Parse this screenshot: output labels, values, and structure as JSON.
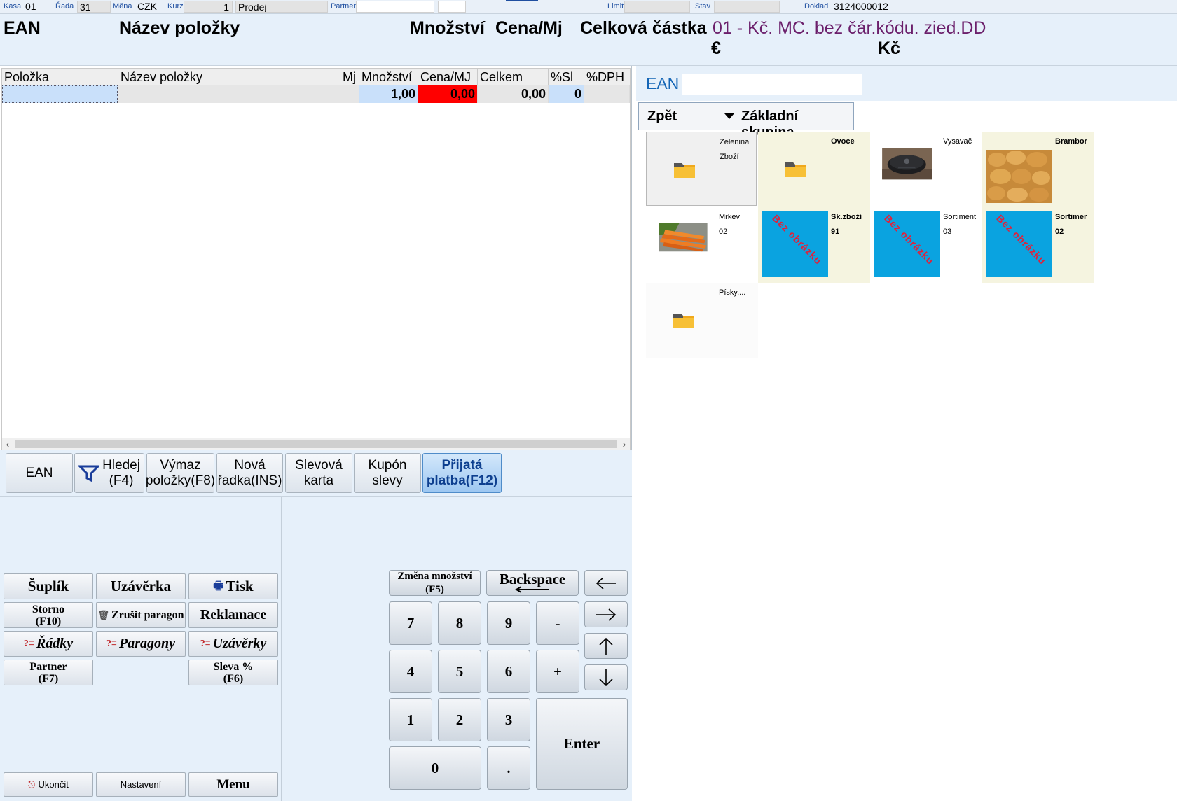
{
  "topbar": {
    "kasa_label": "Kasa",
    "kasa": "01",
    "rada_label": "Řada",
    "rada": "31",
    "mena_label": "Měna",
    "mena": "CZK",
    "kurz_label": "Kurz",
    "kurz": "1",
    "mode": "Prodej",
    "partner_label": "Partner",
    "partner": "",
    "limit_label": "Limit",
    "limit": "",
    "stav_label": "Stav",
    "stav": "",
    "doklad_label": "Doklad",
    "doklad": "3124000012"
  },
  "header": {
    "ean": "EAN",
    "nazev": "Název položky",
    "mnozstvi": "Množství",
    "cena": "Cena/Mj",
    "celkova": "Celková částka",
    "price_list": "01 - Kč. MC. bez čár.kódu. zied.DD",
    "currency_eur": "€",
    "currency_czk": "Kč"
  },
  "grid": {
    "columns": [
      "Položka",
      "Název položky",
      "Mj",
      "Množství",
      "Cena/MJ",
      "Celkem",
      "%Sl",
      "%DPH"
    ],
    "row": {
      "polozka": "",
      "nazev": "",
      "mj": "",
      "mnozstvi": "1,00",
      "cena": "0,00",
      "celkem": "0,00",
      "sl": "0",
      "dph": ""
    }
  },
  "func_buttons": {
    "ean": "EAN",
    "hledej_1": "Hledej",
    "hledej_2": "(F4)",
    "vymaz_1": "Výmaz",
    "vymaz_2": "položky(F8)",
    "nova_1": "Nová",
    "nova_2": "řadka(INS)",
    "slevova_1": "Slevová",
    "slevova_2": "karta",
    "kupon_1": "Kupón",
    "kupon_2": "slevy",
    "prijata_1": "Přijatá",
    "prijata_2": "platba(F12)"
  },
  "controls": {
    "suplik": "Šuplík",
    "uzaverka": "Uzávěrka",
    "tisk": "Tisk",
    "storno_1": "Storno",
    "storno_2": "(F10)",
    "zrusit": "Zrušit paragon",
    "reklamace": "Reklamace",
    "radky": "Řádky",
    "paragony": "Paragony",
    "uzaverky": "Uzávěrky",
    "partner_1": "Partner",
    "partner_2": "(F7)",
    "sleva_1": "Sleva %",
    "sleva_2": "(F6)",
    "ukoncit": "Ukončit",
    "nastaveni": "Nastavení",
    "menu": "Menu"
  },
  "numpad": {
    "zmena_1": "Změna množství",
    "zmena_2": "(F5)",
    "backspace": "Backspace",
    "k7": "7",
    "k8": "8",
    "k9": "9",
    "minus": "-",
    "k4": "4",
    "k5": "5",
    "k6": "6",
    "plus": "+",
    "k1": "1",
    "k2": "2",
    "k3": "3",
    "k0": "0",
    "dot": ".",
    "enter": "Enter"
  },
  "right": {
    "ean_label": "EAN",
    "ean_value": "",
    "back": "Zpět",
    "group": "Základní skupina"
  },
  "tiles": [
    {
      "name": "Zelenina",
      "sub": "Zboží",
      "image": "folder-icon"
    },
    {
      "name": "Ovoce",
      "sub": "",
      "image": "folder-icon"
    },
    {
      "name": "Vysavač",
      "sub": "",
      "image": "robot-vacuum-photo"
    },
    {
      "name": "Brambor",
      "sub": "",
      "image": "potatoes-photo"
    },
    {
      "name": "Mrkev",
      "sub": "02",
      "image": "carrots-photo"
    },
    {
      "name": "Sk.zboží",
      "sub": "91",
      "image": "no-image",
      "no_image_text": "Bez obrázku"
    },
    {
      "name": "Sortiment",
      "sub": "03",
      "image": "no-image",
      "no_image_text": "Bez obrázku"
    },
    {
      "name": "Sortimer",
      "sub": "02",
      "image": "no-image",
      "no_image_text": "Bez obrázku"
    },
    {
      "name": "Písky....",
      "sub": "",
      "image": "folder-icon"
    }
  ],
  "colors": {
    "price_red": "#ff0000",
    "cell_blue": "#c9e0fa",
    "tile_beige": "#f5f4e0",
    "no_image_blue": "#0aa3e0",
    "accent_purple": "#6b1f6b"
  }
}
